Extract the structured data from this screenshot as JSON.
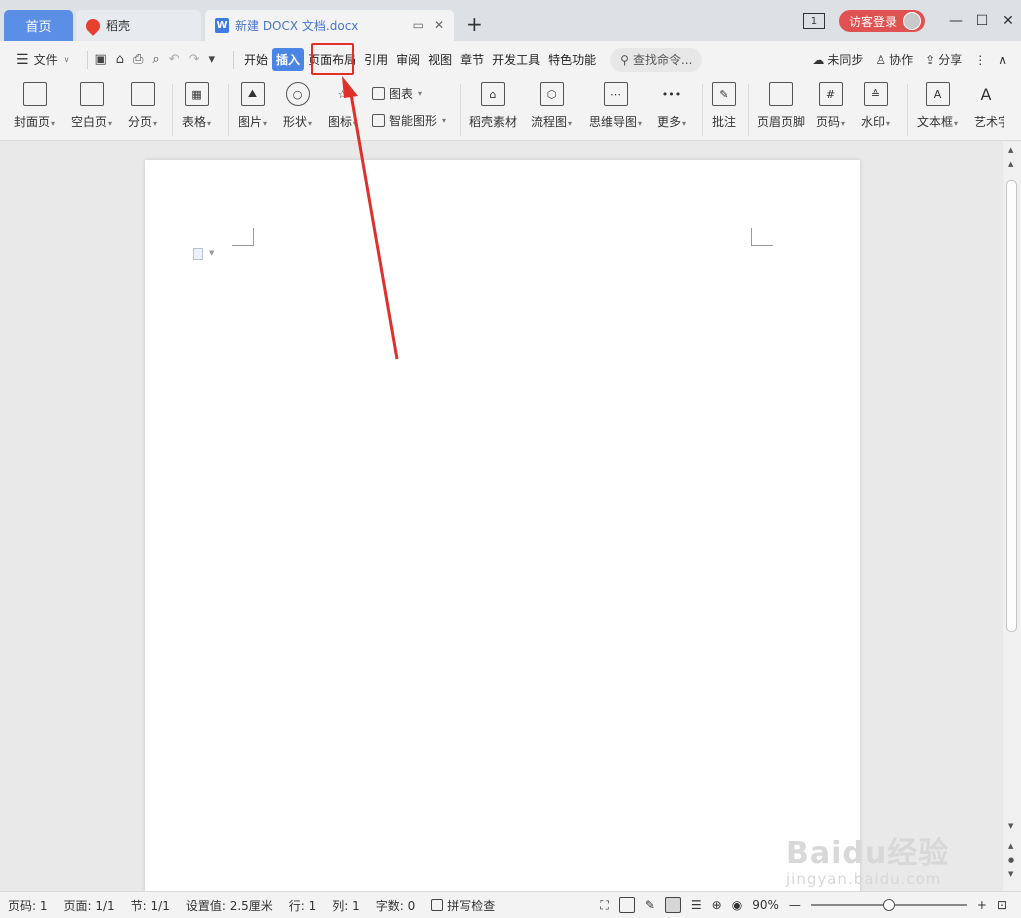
{
  "tabs": {
    "home": "首页",
    "daoke": "稻壳",
    "doc": "新建 DOCX 文档.docx",
    "doc_icon": "W"
  },
  "window": {
    "count": "1",
    "login": "访客登录",
    "minimize": "—",
    "restore": "☐",
    "close": "✕"
  },
  "menu": {
    "file": "文件",
    "items": [
      "开始",
      "插入",
      "页面布局",
      "引用",
      "审阅",
      "视图",
      "章节",
      "开发工具",
      "特色功能"
    ],
    "active": "插入",
    "search": "查找命令...",
    "sync": "未同步",
    "collab": "协作",
    "share": "分享"
  },
  "ribbon": {
    "cover": "封面页",
    "blank": "空白页",
    "page_break": "分页",
    "table": "表格",
    "picture": "图片",
    "shape": "形状",
    "icon": "图标",
    "chart": "图表",
    "smart_art": "智能图形",
    "daoke_assets": "稻壳素材",
    "flowchart": "流程图",
    "mindmap": "思维导图",
    "more": "更多",
    "comment": "批注",
    "header_footer": "页眉页脚",
    "page_number": "页码",
    "watermark": "水印",
    "textbox": "文本框",
    "wordart": "艺术字"
  },
  "status": {
    "page_num": "页码: 1",
    "pages": "页面: 1/1",
    "section": "节: 1/1",
    "setting": "设置值: 2.5厘米",
    "row": "行: 1",
    "col": "列: 1",
    "words": "字数: 0",
    "spell": "拼写检查",
    "zoom": "90%"
  },
  "zoom_level": 0.46,
  "watermark": {
    "main": "Baidu经验",
    "sub": "jingyan.baidu.com"
  },
  "colors": {
    "accent": "#4a85e3",
    "annotation": "#e0302b",
    "login": "#e05252"
  }
}
